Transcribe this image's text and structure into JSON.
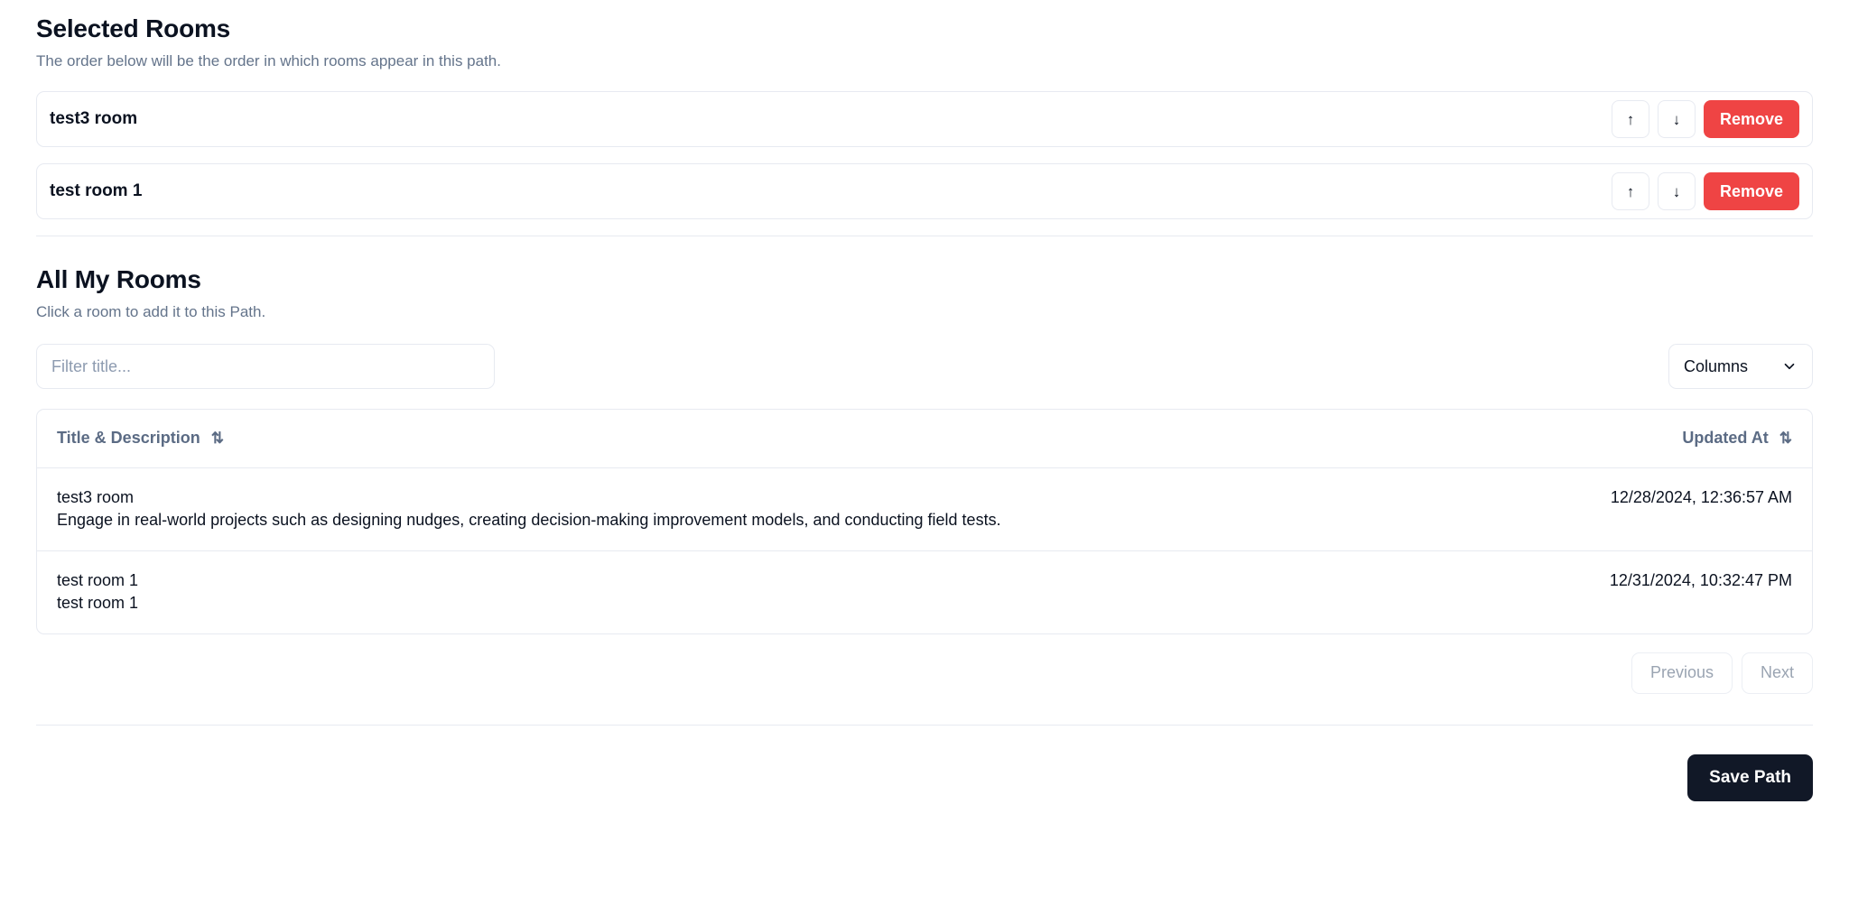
{
  "selected_section": {
    "title": "Selected Rooms",
    "subtitle": "The order below will be the order in which rooms appear in this path.",
    "rows": [
      {
        "title": "test3 room",
        "move_up": "↑",
        "move_down": "↓",
        "remove_label": "Remove"
      },
      {
        "title": "test room 1",
        "move_up": "↑",
        "move_down": "↓",
        "remove_label": "Remove"
      }
    ]
  },
  "all_rooms_section": {
    "title": "All My Rooms",
    "subtitle": "Click a room to add it to this Path.",
    "filter": {
      "value": "",
      "placeholder": "Filter title..."
    },
    "columns_button": {
      "label": "Columns",
      "icon": "chevron-down-icon"
    },
    "table": {
      "headers": [
        {
          "label": "Title & Description",
          "sort_icon": "⇅"
        },
        {
          "label": "Updated At",
          "sort_icon": "⇅"
        }
      ],
      "rows": [
        {
          "title": "test3 room",
          "description": "Engage in real-world projects such as designing nudges, creating decision-making improvement models, and conducting field tests.",
          "updated_at": "12/28/2024, 12:36:57 AM"
        },
        {
          "title": "test room 1",
          "description": "test room 1",
          "updated_at": "12/31/2024, 10:32:47 PM"
        }
      ]
    },
    "pagination": {
      "previous_label": "Previous",
      "next_label": "Next"
    }
  },
  "footer": {
    "save_label": "Save Path"
  },
  "colors": {
    "remove_red": "#ef4444",
    "save_dark": "#111827",
    "muted_text": "#64748b",
    "border": "#e7eaf1"
  }
}
